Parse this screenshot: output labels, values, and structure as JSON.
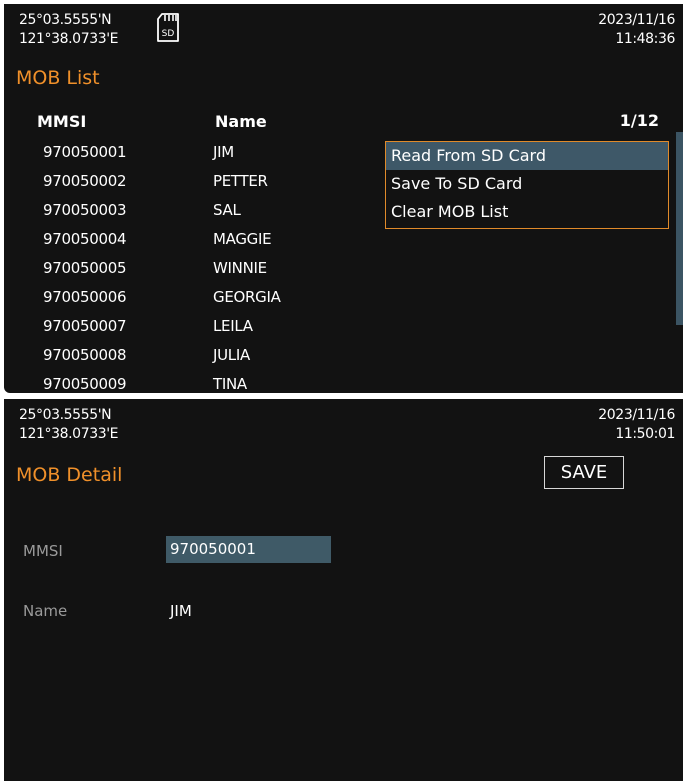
{
  "list_screen": {
    "position": {
      "lat": "25°03.5555'N",
      "lon": "121°38.0733'E"
    },
    "date": "2023/11/16",
    "time": "11:48:36",
    "title": "MOB List",
    "headers": {
      "mmsi": "MMSI",
      "name": "Name"
    },
    "page": "1/12",
    "rows": [
      {
        "mmsi": "970050001",
        "name": "JIM"
      },
      {
        "mmsi": "970050002",
        "name": "PETTER"
      },
      {
        "mmsi": "970050003",
        "name": "SAL"
      },
      {
        "mmsi": "970050004",
        "name": "MAGGIE"
      },
      {
        "mmsi": "970050005",
        "name": "WINNIE"
      },
      {
        "mmsi": "970050006",
        "name": "GEORGIA"
      },
      {
        "mmsi": "970050007",
        "name": "LEILA"
      },
      {
        "mmsi": "970050008",
        "name": "JULIA"
      },
      {
        "mmsi": "970050009",
        "name": "TINA"
      }
    ],
    "menu": {
      "items": [
        "Read From SD Card",
        "Save To SD Card",
        "Clear MOB List"
      ],
      "selected_index": 0
    },
    "sd_icon_label": "SD"
  },
  "detail_screen": {
    "position": {
      "lat": "25°03.5555'N",
      "lon": "121°38.0733'E"
    },
    "date": "2023/11/16",
    "time": "11:50:01",
    "title": "MOB Detail",
    "save_label": "SAVE",
    "fields": {
      "mmsi_label": "MMSI",
      "mmsi_value": "970050001",
      "name_label": "Name",
      "name_value": "JIM"
    }
  },
  "colors": {
    "accent": "#f0902a",
    "highlight": "#3e5868",
    "background": "#121212"
  }
}
